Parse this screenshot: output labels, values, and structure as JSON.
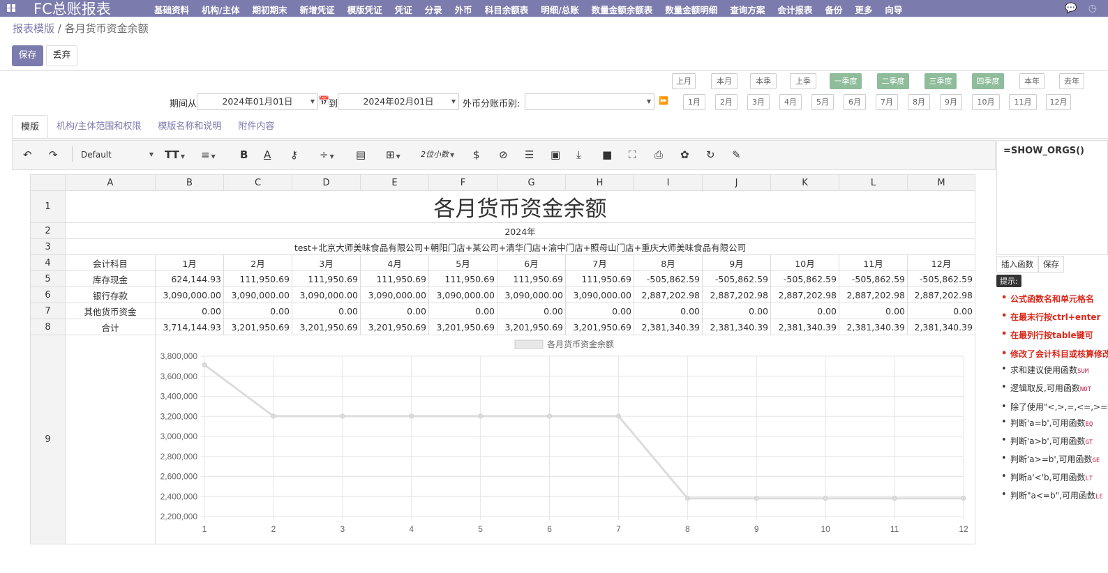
{
  "topbar": {
    "brand": "FC总账报表",
    "menu": [
      "基础资料",
      "机构/主体",
      "期初期末",
      "新增凭证",
      "模版凭证",
      "凭证",
      "分录",
      "外币",
      "科目余额表",
      "明细/总账",
      "数量金额余额表",
      "数量金额明细",
      "查询方案",
      "会计报表",
      "备份",
      "更多",
      "向导"
    ],
    "icons": [
      "chat-icon",
      "clock-icon"
    ]
  },
  "breadcrumb": {
    "parent": "报表模版",
    "separator": " / ",
    "current": "各月货币资金余额"
  },
  "actions": {
    "save": "保存",
    "discard": "丢弃"
  },
  "period_buttons_row1": [
    "上月",
    "本月",
    "本季",
    "上季",
    "一季度",
    "二季度",
    "三季度",
    "四季度",
    "本年",
    "去年"
  ],
  "period_buttons_row2": [
    "1月",
    "2月",
    "3月",
    "4月",
    "5月",
    "6月",
    "7月",
    "8月",
    "9月",
    "10月",
    "11月",
    "12月"
  ],
  "filters": {
    "from_label": "期间从",
    "from_value": "2024年01月01日",
    "to_label": "到",
    "to_value": "2024年02月01日",
    "currency_label": "外币分账币别:",
    "currency_value": ""
  },
  "tabs": [
    "模版",
    "机构/主体范围和权限",
    "模版名称和说明",
    "附件内容"
  ],
  "toolbar": {
    "font": "Default",
    "decimals": "2位小数"
  },
  "formula": {
    "value": "=SHOW_ORGS()",
    "insert_btn": "插入函数",
    "save_btn": "保存",
    "tip_label": "提示:"
  },
  "tips": [
    {
      "text": "公式函数名和单元格名",
      "red": true
    },
    {
      "text": "在最末行按ctrl+enter",
      "red": true
    },
    {
      "text": "在最列行按table键可",
      "red": true
    },
    {
      "text": "修改了会计科目或核算修改",
      "red": true
    },
    {
      "text": "求和建议使用函数",
      "code": "SUM",
      "red": false
    },
    {
      "text": "逻辑取反,可用函数",
      "code": "NOT",
      "red": false
    },
    {
      "text": "除了使用\"<,>,=,<=,>=数",
      "red": false
    },
    {
      "text": "判断'a=b',可用函数",
      "code": "EQ",
      "red": false
    },
    {
      "text": "判断'a>b',可用函数",
      "code": "GT",
      "red": false
    },
    {
      "text": "判断'a>=b',可用函数",
      "code": "GE",
      "red": false
    },
    {
      "text": "判断a'<'b,可用函数",
      "code": "LT",
      "red": false
    },
    {
      "text": "判断\"a<=b\",可用函数",
      "code": "LE",
      "red": false
    }
  ],
  "sheet": {
    "columns": [
      "A",
      "B",
      "C",
      "D",
      "E",
      "F",
      "G",
      "H",
      "I",
      "J",
      "K",
      "L",
      "M"
    ],
    "rows": [
      "1",
      "2",
      "3",
      "4",
      "5",
      "6",
      "7",
      "8",
      "9"
    ],
    "title": "各月货币资金余额",
    "year": "2024年",
    "orgs": "test+北京大师美味食品有限公司+朝阳门店+某公司+清华门店+渝中门店+照母山门店+重庆大师美味食品有限公司",
    "header": [
      "会计科目",
      "1月",
      "2月",
      "3月",
      "4月",
      "5月",
      "6月",
      "7月",
      "8月",
      "9月",
      "10月",
      "11月",
      "12月"
    ],
    "data": [
      [
        "库存现金",
        "624,144.93",
        "111,950.69",
        "111,950.69",
        "111,950.69",
        "111,950.69",
        "111,950.69",
        "111,950.69",
        "-505,862.59",
        "-505,862.59",
        "-505,862.59",
        "-505,862.59",
        "-505,862.59"
      ],
      [
        "银行存款",
        "3,090,000.00",
        "3,090,000.00",
        "3,090,000.00",
        "3,090,000.00",
        "3,090,000.00",
        "3,090,000.00",
        "3,090,000.00",
        "2,887,202.98",
        "2,887,202.98",
        "2,887,202.98",
        "2,887,202.98",
        "2,887,202.98"
      ],
      [
        "其他货币资金",
        "0.00",
        "0.00",
        "0.00",
        "0.00",
        "0.00",
        "0.00",
        "0.00",
        "0.00",
        "0.00",
        "0.00",
        "0.00",
        "0.00"
      ],
      [
        "合计",
        "3,714,144.93",
        "3,201,950.69",
        "3,201,950.69",
        "3,201,950.69",
        "3,201,950.69",
        "3,201,950.69",
        "3,201,950.69",
        "2,381,340.39",
        "2,381,340.39",
        "2,381,340.39",
        "2,381,340.39",
        "2,381,340.39"
      ]
    ]
  },
  "chart_data": {
    "type": "line",
    "legend": "各月货币资金余额",
    "legend_position": "top",
    "x": [
      1,
      2,
      3,
      4,
      5,
      6,
      7,
      8,
      9,
      10,
      11,
      12
    ],
    "series": [
      {
        "name": "各月货币资金余额",
        "values": [
          3714144.93,
          3201950.69,
          3201950.69,
          3201950.69,
          3201950.69,
          3201950.69,
          3201950.69,
          2381340.39,
          2381340.39,
          2381340.39,
          2381340.39,
          2381340.39
        ]
      }
    ],
    "yticks": [
      3800000,
      3600000,
      3400000,
      3200000,
      3000000,
      2800000,
      2600000,
      2400000,
      2200000
    ],
    "ytick_labels": [
      "3,800,000",
      "3,600,000",
      "3,400,000",
      "3,200,000",
      "3,000,000",
      "2,800,000",
      "2,600,000",
      "2,400,000",
      "2,200,000"
    ],
    "ylim": [
      2200000,
      3800000
    ],
    "grid": true,
    "color": "#dddddd"
  }
}
